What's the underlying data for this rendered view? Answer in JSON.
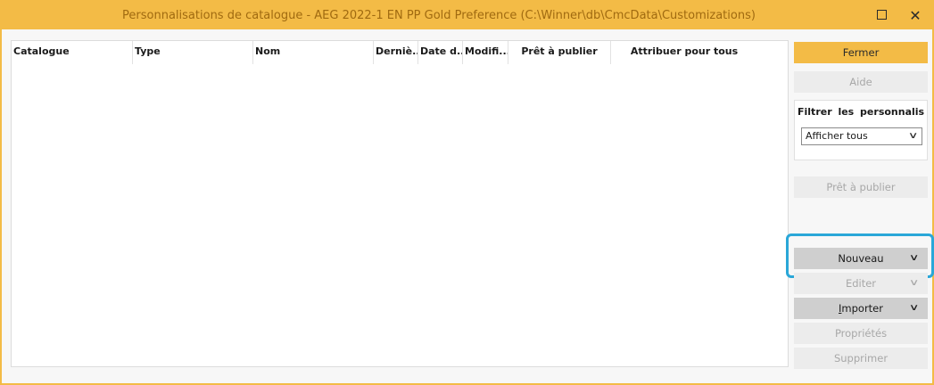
{
  "window": {
    "title": "Personnalisations de catalogue - AEG 2022-1 EN PP Gold Preference (C:\\Winner\\db\\CmcData\\Customizations)",
    "maximize_icon": "maximize-icon",
    "close_icon": "close-icon",
    "accent_color": "#f3bb46"
  },
  "grid": {
    "columns": [
      "Catalogue",
      "Type",
      "Nom",
      "Derniè...",
      "Date d...",
      "Modifi...",
      "Prêt à publier",
      "Attribuer pour tous"
    ],
    "rows": []
  },
  "sidebar": {
    "close_label": "Fermer",
    "help_label": "Aide",
    "filter_label": "Filtrer les personnalisati...",
    "filter_value": "Afficher tous",
    "ready_label": "Prêt à publier",
    "new_label": "Nouveau",
    "edit_label": "Editer",
    "import_label_underlined": "I",
    "import_label_rest": "mporter",
    "properties_label": "Propriétés",
    "delete_label": "Supprimer",
    "chevron_icon": "chevron-down-icon",
    "highlight_color": "#2aa7d8"
  }
}
